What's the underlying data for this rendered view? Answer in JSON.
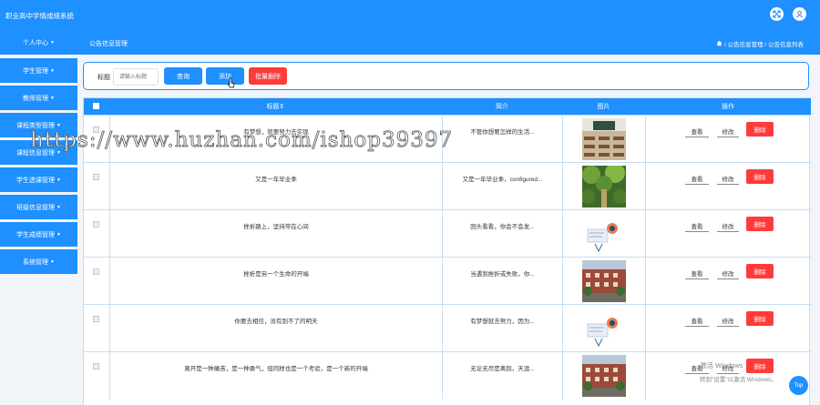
{
  "header": {
    "app_title": "职业高中学情成绩系统"
  },
  "sidebar": {
    "items": [
      {
        "label": "个人中心"
      },
      {
        "label": "学生管理"
      },
      {
        "label": "教师管理"
      },
      {
        "label": "课程类型管理"
      },
      {
        "label": "课程信息管理"
      },
      {
        "label": "学生选课管理"
      },
      {
        "label": "班级信息管理"
      },
      {
        "label": "学生成绩管理"
      },
      {
        "label": "系统管理"
      }
    ]
  },
  "subbar": {
    "page_title": "公告信息管理",
    "breadcrumb": "/ 公告信息管理 / 公告信息列表"
  },
  "search": {
    "label": "标题",
    "placeholder": "请输入标题",
    "query_label": "查询",
    "add_label": "添加",
    "batch_delete_label": "批量删除"
  },
  "table": {
    "columns": {
      "title": "标题⇕",
      "intro": "简介",
      "image": "图片",
      "actions": "操作"
    },
    "action_labels": {
      "view": "查看",
      "edit": "修改",
      "delete": "删除"
    },
    "rows": [
      {
        "title": "有梦想，就要努力去实现",
        "intro": "不管你想要怎样的生活...",
        "image": "classroom"
      },
      {
        "title": "又是一年毕业季",
        "intro": "又是一年毕业季，configured...",
        "image": "forest"
      },
      {
        "title": "挫折路上，坚持常在心间",
        "intro": "回头看看，你会不会发...",
        "image": "graphic"
      },
      {
        "title": "挫折是另一个生命的开端",
        "intro": "当遇到挫折或失败，你...",
        "image": "campus"
      },
      {
        "title": "你要去相信，没有到不了的明天",
        "intro": "有梦想就去努力，因为...",
        "image": "graphic"
      },
      {
        "title": "离开是一种痛苦，是一种勇气，但同样也是一个考验，是一个新的开端",
        "intro": "无论无尽是离别，天涯...",
        "image": "campus"
      }
    ]
  },
  "watermark": "https://www.huzhan.com/ishop39397",
  "windows_notice": {
    "line1": "激活 Windows",
    "line2": "转到\"设置\"以激活 Windows。"
  },
  "top_button": "Top",
  "colors": {
    "primary": "#1e90ff",
    "danger": "#ff3b3b",
    "border": "#c6ddf3"
  }
}
